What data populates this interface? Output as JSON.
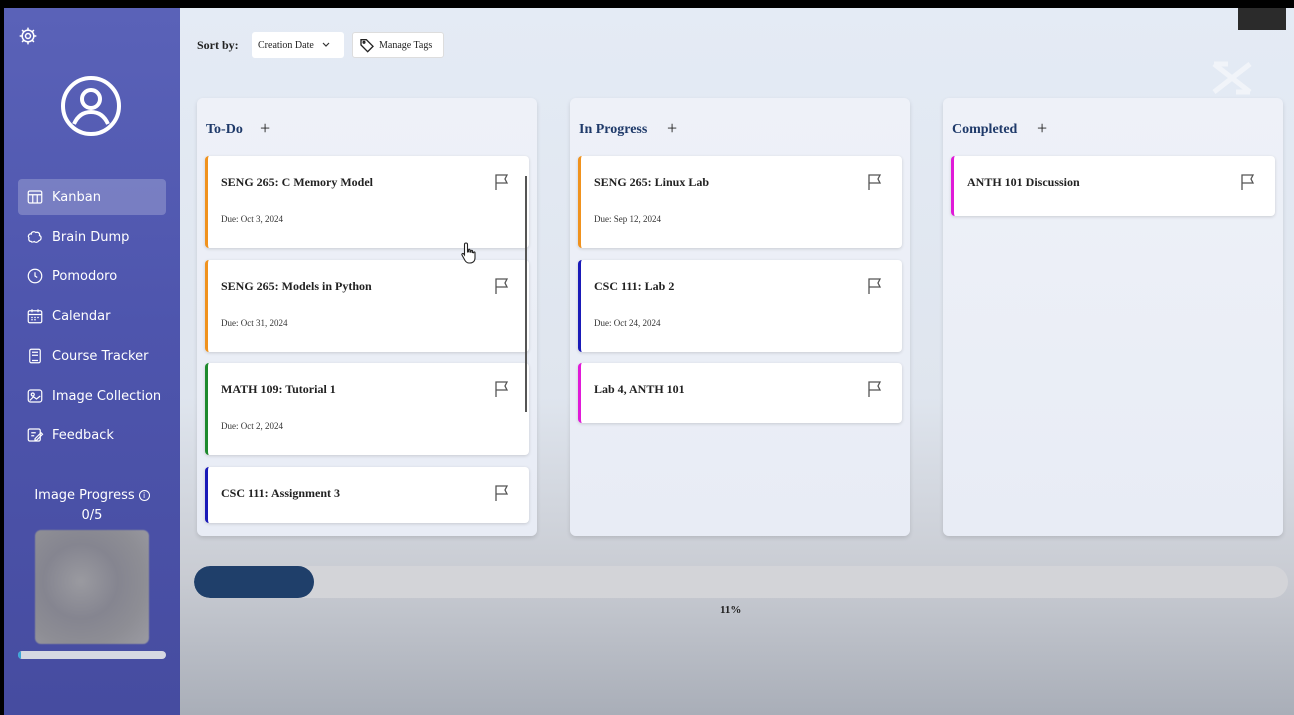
{
  "sidebar": {
    "nav": [
      {
        "label": "Kanban",
        "icon": "kanban-icon",
        "active": true
      },
      {
        "label": "Brain Dump",
        "icon": "brain-icon"
      },
      {
        "label": "Pomodoro",
        "icon": "clock-icon"
      },
      {
        "label": "Calendar",
        "icon": "calendar-icon"
      },
      {
        "label": "Course Tracker",
        "icon": "book-icon"
      },
      {
        "label": "Image Collection",
        "icon": "image-icon"
      },
      {
        "label": "Feedback",
        "icon": "edit-icon"
      }
    ],
    "image_progress_label": "Image Progress",
    "image_progress_count": "0/5",
    "image_progress_fraction": 0.02
  },
  "toolbar": {
    "sort_label": "Sort by:",
    "sort_value": "Creation Date",
    "manage_tags_label": "Manage Tags"
  },
  "columns": [
    {
      "title": "To-Do",
      "cards": [
        {
          "title": "SENG 265: C Memory Model",
          "due": "Due: Oct 3, 2024",
          "color": "#f0921e"
        },
        {
          "title": "SENG 265: Models in Python",
          "due": "Due: Oct 31, 2024",
          "color": "#f0921e"
        },
        {
          "title": "MATH 109: Tutorial 1",
          "due": "Due: Oct 2, 2024",
          "color": "#1e8a2e"
        },
        {
          "title": "CSC 111: Assignment 3",
          "due": "",
          "color": "#1a1ab8"
        }
      ]
    },
    {
      "title": "In Progress",
      "cards": [
        {
          "title": "SENG 265: Linux Lab",
          "due": "Due: Sep 12, 2024",
          "color": "#f0921e"
        },
        {
          "title": "CSC 111: Lab 2",
          "due": "Due: Oct 24, 2024",
          "color": "#1a1ab8"
        },
        {
          "title": "Lab 4, ANTH 101",
          "due": "",
          "color": "#e01ad8"
        }
      ]
    },
    {
      "title": "Completed",
      "cards": [
        {
          "title": "ANTH 101 Discussion",
          "due": "",
          "color": "#e01ad8"
        }
      ]
    }
  ],
  "overall_progress": {
    "percent_label": "11%",
    "fraction": 0.11
  }
}
